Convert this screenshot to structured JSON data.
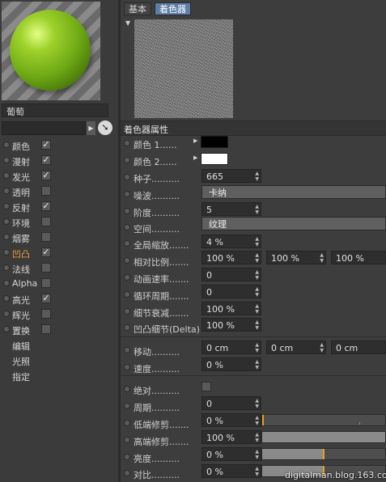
{
  "material": {
    "name": "葡萄",
    "field_value": ""
  },
  "channels": [
    {
      "label": "颜色",
      "checked": true
    },
    {
      "label": "漫射",
      "checked": true
    },
    {
      "label": "发光",
      "checked": true
    },
    {
      "label": "透明",
      "checked": false
    },
    {
      "label": "反射",
      "checked": true
    },
    {
      "label": "环境",
      "checked": false
    },
    {
      "label": "烟雾",
      "checked": false
    },
    {
      "label": "凹凸",
      "checked": true,
      "active": true
    },
    {
      "label": "法线",
      "checked": false
    },
    {
      "label": "Alpha",
      "checked": false
    },
    {
      "label": "高光",
      "checked": true
    },
    {
      "label": "辉光",
      "checked": false
    },
    {
      "label": "置换",
      "checked": false
    }
  ],
  "sub_links": [
    "编辑",
    "光照",
    "指定"
  ],
  "tabs": [
    {
      "label": "基本",
      "selected": false
    },
    {
      "label": "着色器",
      "selected": true
    }
  ],
  "section_title": "着色器属性",
  "params": {
    "color1": {
      "label": "颜色 1",
      "dots": "......",
      "color": "#000000"
    },
    "color2": {
      "label": "颜色 2",
      "dots": "......",
      "color": "#ffffff"
    },
    "seed": {
      "label": "种子",
      "dots": "..........",
      "value": "665"
    },
    "noise": {
      "label": "噪波",
      "dots": "..........",
      "value": "卡纳"
    },
    "octaves": {
      "label": "阶度",
      "dots": "..........",
      "value": "5"
    },
    "space": {
      "label": "空间",
      "dots": "..........",
      "value": "纹理"
    },
    "global_scale": {
      "label": "全局缩放",
      "dots": ".......",
      "value": "4 %"
    },
    "relative_scale": {
      "label": "相对比例",
      "dots": ".......",
      "values": [
        "100 %",
        "100 %",
        "100 %"
      ]
    },
    "anim_speed": {
      "label": "动画速率",
      "dots": ".......",
      "value": "0"
    },
    "loop_period": {
      "label": "循环周期",
      "dots": ".......",
      "value": "0"
    },
    "detail_atten": {
      "label": "细节衰减",
      "dots": ".......",
      "value": "100 %"
    },
    "bump_detail": {
      "label": "凹凸细节(Delta)",
      "dots": "",
      "value": "100 %"
    },
    "move": {
      "label": "移动",
      "dots": "..........",
      "values": [
        "0 cm",
        "0 cm",
        "0 cm"
      ]
    },
    "speed": {
      "label": "速度",
      "dots": "..........",
      "value": "0 %"
    },
    "absolute": {
      "label": "绝对",
      "dots": "..........",
      "checked": false
    },
    "period": {
      "label": "周期",
      "dots": "..........",
      "value": "0"
    },
    "low_clip": {
      "label": "低端修剪",
      "dots": ".......",
      "value": "0 %",
      "level": 0
    },
    "high_clip": {
      "label": "高端修剪",
      "dots": ".......",
      "value": "100 %",
      "level": 1
    },
    "brightness": {
      "label": "亮度",
      "dots": "..........",
      "value": "0 %",
      "level": 0.5
    },
    "contrast": {
      "label": "对比",
      "dots": "..........",
      "value": "0 %",
      "level": 0.5
    }
  },
  "watermark": "digitalman.blog.163.com",
  "colors": {
    "accent_orange": "#f0a23a",
    "tab_selected": "#5d7ea6",
    "marker": "#e8a21a"
  }
}
